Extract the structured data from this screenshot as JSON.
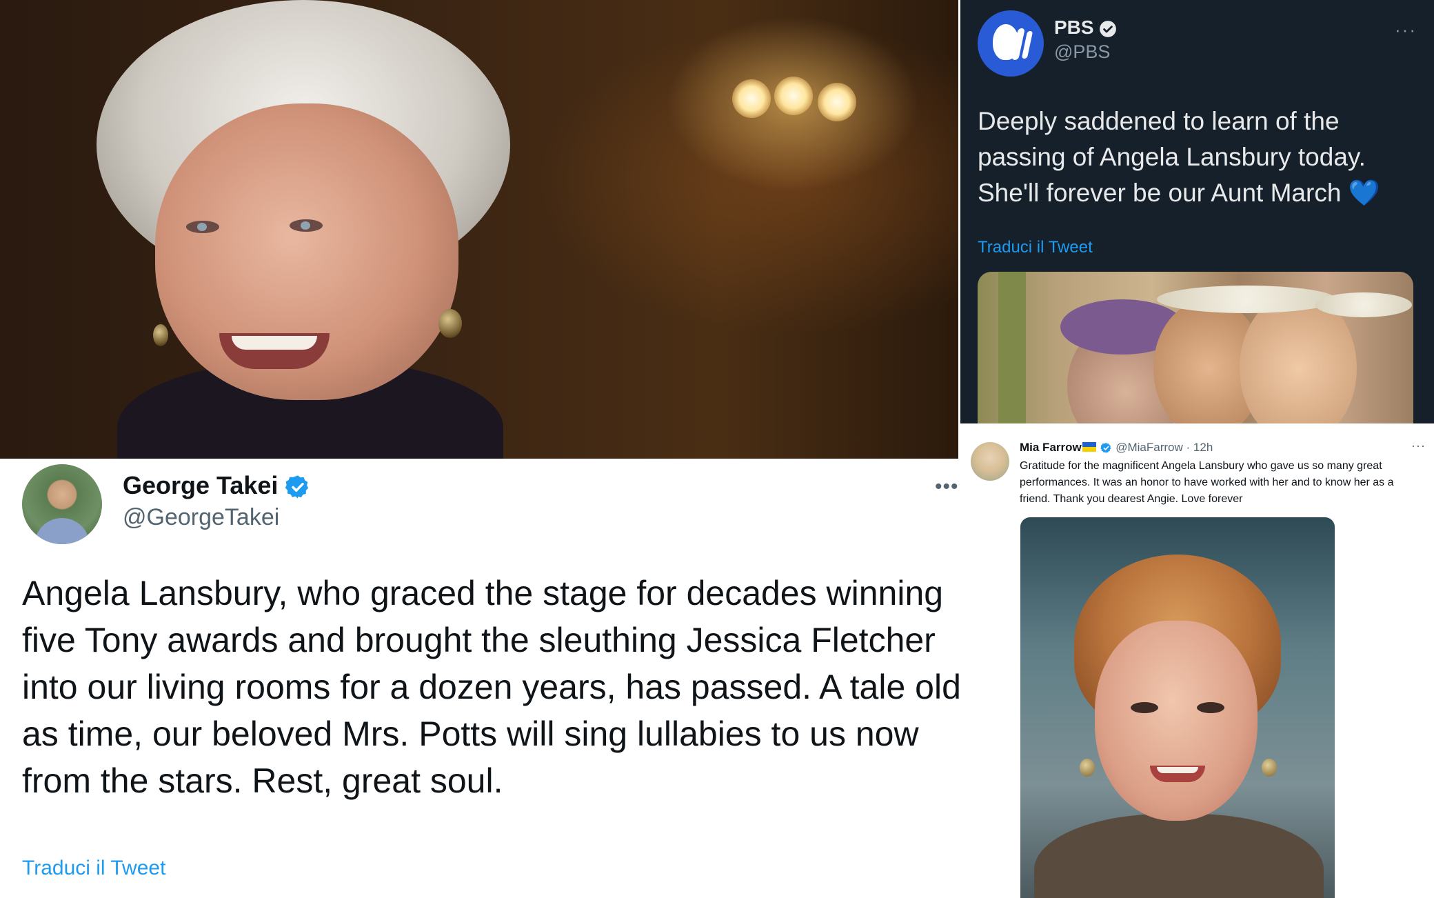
{
  "pbs_tweet": {
    "name": "PBS",
    "handle": "@PBS",
    "text": "Deeply saddened to learn of the passing of Angela Lansbury today. She'll forever be our Aunt March 💙",
    "translate": "Traduci il Tweet",
    "more": "···",
    "avatar_icon": "pbs-logo-icon",
    "colors": {
      "background": "#15202b",
      "link": "#1d9bf0"
    }
  },
  "takei_tweet": {
    "name": "George Takei",
    "handle": "@GeorgeTakei",
    "text": "Angela Lansbury, who graced the stage for decades winning five Tony awards and brought the sleuthing Jessica Fletcher into our living rooms for a dozen years, has passed. A tale old as time, our beloved Mrs. Potts will sing lullabies to us now from the stars. Rest, great soul.",
    "translate": "Traduci il Tweet",
    "more": "•••"
  },
  "mia_tweet": {
    "name": "Mia Farrow",
    "handle": "@MiaFarrow",
    "separator": "·",
    "time": "12h",
    "text": "Gratitude for the magnificent Angela Lansbury who gave us so many great performances. It was an honor to have worked with her and to know her as a friend. Thank you dearest Angie. Love forever",
    "more": "···",
    "flag_icon": "ukraine-flag-icon"
  },
  "colors": {
    "verified": "#1d9bf0",
    "text_dark": "#0f1419",
    "text_muted": "#536471"
  }
}
